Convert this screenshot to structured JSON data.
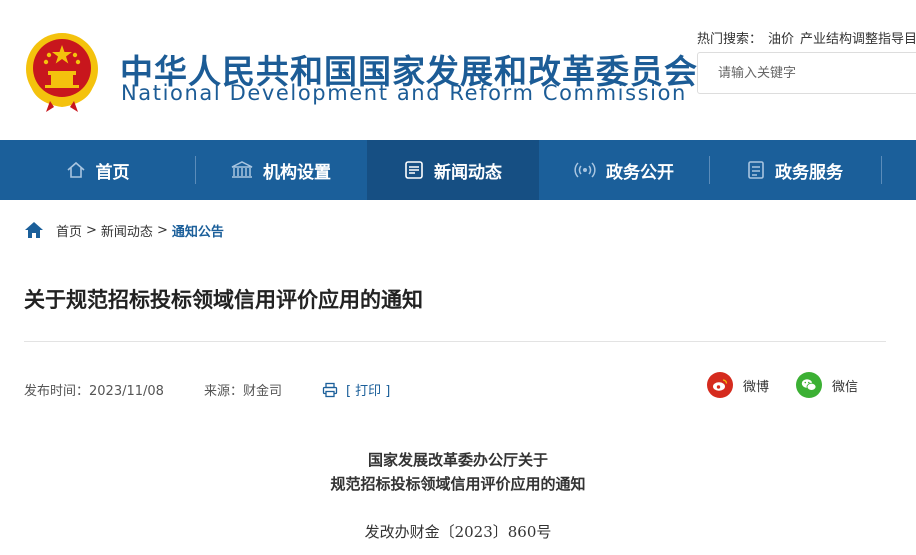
{
  "header": {
    "title_cn": "中华人民共和国国家发展和改革委员会",
    "title_en": "National Development and Reform Commission",
    "hot_search_label": "热门搜索：",
    "hot_search_items": [
      "油价",
      "产业结构调整指导目录"
    ],
    "search_placeholder": "请输入关键字"
  },
  "nav": {
    "items": [
      {
        "label": "首页",
        "icon": "home-icon"
      },
      {
        "label": "机构设置",
        "icon": "building-icon"
      },
      {
        "label": "新闻动态",
        "icon": "news-icon"
      },
      {
        "label": "政务公开",
        "icon": "broadcast-icon"
      },
      {
        "label": "政务服务",
        "icon": "document-icon"
      }
    ],
    "active_index": 2
  },
  "breadcrumb": {
    "items": [
      "首页",
      "新闻动态"
    ],
    "separator": ">",
    "current": "通知公告"
  },
  "article": {
    "title": "关于规范招标投标领域信用评价应用的通知",
    "publish_time": "发布时间：2023/11/08",
    "source": "来源：财金司",
    "print_label": "[ 打印 ]",
    "share_weibo": "微博",
    "share_wechat": "微信",
    "doc_head_line1": "国家发展改革委办公厅关于",
    "doc_head_line2": "规范招标投标领域信用评价应用的通知",
    "doc_number": "发改办财金〔2023〕860号"
  },
  "colors": {
    "brand_blue": "#1c5c96",
    "nav_bg": "#1b5f9a",
    "nav_active": "#164f83",
    "weibo_red": "#d52b1e",
    "wechat_green": "#3cb034",
    "emblem_red": "#c8161d",
    "emblem_gold": "#f4c20d"
  }
}
